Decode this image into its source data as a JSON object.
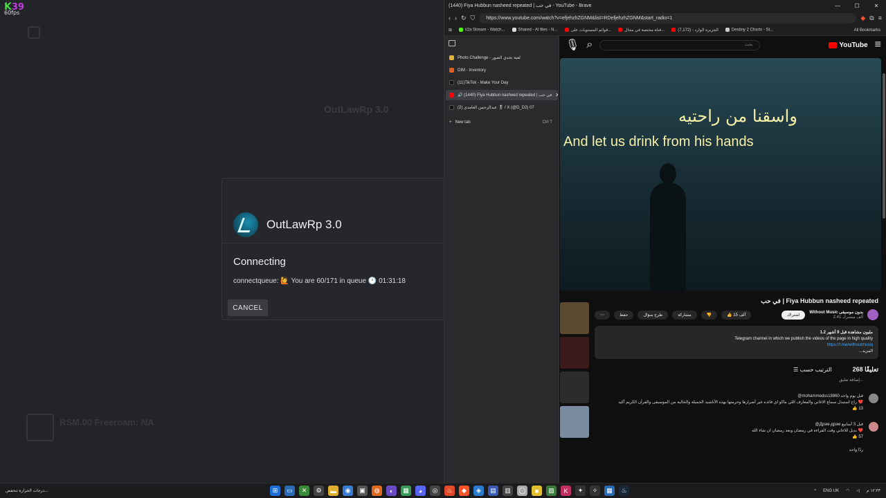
{
  "overlay": {
    "fps_k": "K",
    "fps_value": "39",
    "fps_label": "60fps"
  },
  "launcher": {
    "bg_server_title": "OutLawRp 3.0",
    "bg_server_sub": "RSM.00 Freeroam: NA"
  },
  "modal": {
    "title": "OutLawRp 3.0",
    "status": "Connecting",
    "queue_text": "connectqueue: 🙋 You are 60/171 in queue 🕐 01:31:18",
    "cancel_label": "CANCEL"
  },
  "browser": {
    "window_title": "(1440) Fiya Hubbun nasheed repeated | في حب - YouTube - Brave",
    "url": "https://www.youtube.com/watch?v=efjehzhZGNM&list=RDefjehzhZGNM&start_radio=1",
    "bookmarks": [
      "ii2a Stream - Watch...",
      "Shared - AI files - N...",
      "قوائم المستويات على...",
      "قناة مختصة في مجال...",
      "الجزيرة الوارد - (7,172)",
      "Destiny 2 Charts - St..."
    ],
    "all_bookmarks": "All Bookmarks",
    "tabs": [
      {
        "label": "Photo Challenge - لعبة تحدي الصور",
        "color": "#e0b040"
      },
      {
        "label": "DIM - Inventory",
        "color": "#e06020"
      },
      {
        "label": "(11)TikTok - Make Your Day",
        "color": "#111111"
      },
      {
        "label": "🔊 (1440) Fiya Hubbun nasheed repeated | في حب",
        "color": "#ff0000"
      },
      {
        "label": "(2) عبدالرحمن الغامدي 🎖 / X (@D_D2) 07",
        "color": "#111111"
      }
    ],
    "new_tab": "New tab",
    "new_tab_shortcut": "Ctrl T"
  },
  "youtube": {
    "search_placeholder": "بحث",
    "logo": "YouTube",
    "lyric_ar": "واسقنا من راحتيه",
    "lyric_en": "And let us drink from his hands",
    "title": "في حب | Fiya Hubbun nasheed repeated",
    "channel": "Without Music بدون موسيقى",
    "subs": "2.41 ألف مشترك",
    "subscribe": "اشتراك",
    "likes": "15 ألف",
    "share": "مشاركة",
    "save": "حفظ",
    "ask": "طرح سؤال",
    "desc_stats": "1.2 مليون مشاهدة قبل 9 أشهر",
    "desc_text": "Telegram channel in which we publish the videos of the page in high quality",
    "desc_link": "https://t.me/withoutmusiq",
    "desc_more": "...المزيد",
    "comments_count": "268 تعليقًا",
    "sort": "الترتيب حسب",
    "add_comment": "إضافة تعليق...",
    "comments": [
      {
        "user": "@mohammedss18860 قبل يوم واحد",
        "text": "راح استبدل سماع الاغاني والمعازف اللي ماكو اي فائده غير أضرارها وحرمتها بهذه الأناشيد الجميلة والخالية من الموسيقى والقرآن الكريم أكيد ❤️",
        "likes": "13"
      },
      {
        "user": "@Дрэм-дрэм قبل 3 أسابيع",
        "text": "بديل للاغاني وقت القراءة في رمضان وبعد رمضان ان شاء الله ❤️",
        "likes": "57"
      }
    ],
    "replies": "ردًا واحد"
  },
  "taskbar": {
    "weather": "درجات الحرارة تنخفض...",
    "lang": "ENG UK",
    "time": "١٢:٣٣ م"
  }
}
